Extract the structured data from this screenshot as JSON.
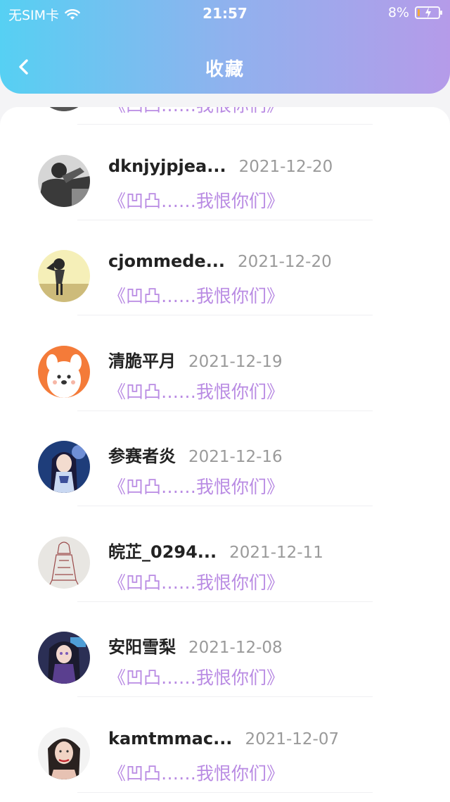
{
  "status_bar": {
    "carrier": "无SIM卡",
    "time": "21:57",
    "battery_percent": "8%",
    "battery_level": 0.08,
    "wifi_icon": "wifi-icon"
  },
  "nav": {
    "title": "收藏",
    "back_icon": "chevron-left-icon"
  },
  "colors": {
    "header_gradient": [
      "#56d0f3",
      "#b59be9"
    ],
    "comment": "#b98be3",
    "date": "#9a9a9a"
  },
  "favorites": [
    {
      "name": "",
      "date": "",
      "comment": "《凹凸……我恨你们》",
      "avatar": "avatar-partial"
    },
    {
      "name": "dknjyjpjea...",
      "date": "2021-12-20",
      "comment": "《凹凸……我恨你们》",
      "avatar": "avatar-bw-portrait"
    },
    {
      "name": "cjommede...",
      "date": "2021-12-20",
      "comment": "《凹凸……我恨你们》",
      "avatar": "avatar-girl-sky"
    },
    {
      "name": "清脆平月",
      "date": "2021-12-19",
      "comment": "《凹凸……我恨你们》",
      "avatar": "avatar-cartoon-dog"
    },
    {
      "name": "参赛者炎",
      "date": "2021-12-16",
      "comment": "《凹凸……我恨你们》",
      "avatar": "avatar-anime-girl-blue"
    },
    {
      "name": "皖芷_0294...",
      "date": "2021-12-11",
      "comment": "《凹凸……我恨你们》",
      "avatar": "avatar-sketch"
    },
    {
      "name": "安阳雪梨",
      "date": "2021-12-08",
      "comment": "《凹凸……我恨你们》",
      "avatar": "avatar-anime-girl-dark"
    },
    {
      "name": "kamtmmac...",
      "date": "2021-12-07",
      "comment": "《凹凸……我恨你们》",
      "avatar": "avatar-woman-portrait"
    }
  ]
}
